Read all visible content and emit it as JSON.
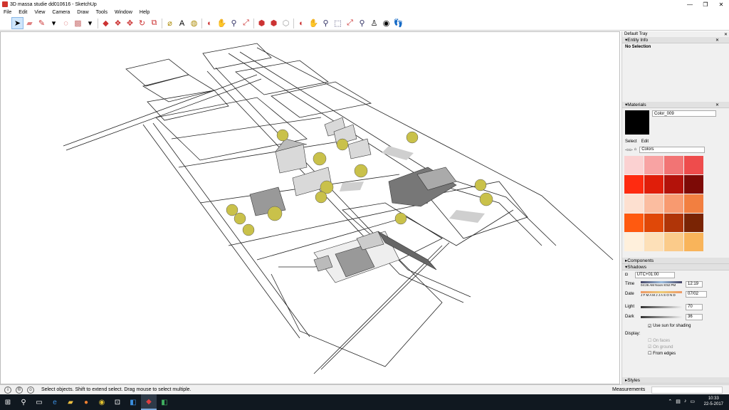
{
  "window": {
    "title": "3D massa studie dd010616 - SketchUp",
    "min": "—",
    "max": "❐",
    "close": "✕"
  },
  "menu": [
    "File",
    "Edit",
    "View",
    "Camera",
    "Draw",
    "Tools",
    "Window",
    "Help"
  ],
  "tray": {
    "title": "Default Tray",
    "entity_info": {
      "header": "Entity Info",
      "value": "No Selection"
    },
    "materials": {
      "header": "Materials",
      "name": "Color_009",
      "tab_select": "Select",
      "tab_edit": "Edit",
      "library": "Colors",
      "swatches": [
        "#fbd1d1",
        "#f8a3a3",
        "#f27474",
        "#ee4c4c",
        "#ff2b10",
        "#e01e0a",
        "#b3120a",
        "#7d0a06",
        "#fde0d0",
        "#fbbda0",
        "#f89a70",
        "#f27f40",
        "#ff5a10",
        "#e04808",
        "#b03508",
        "#7a2404",
        "#fff0dc",
        "#fde0b8",
        "#fbcb8a",
        "#f9b45a"
      ]
    },
    "components": {
      "header": "Components"
    },
    "shadows": {
      "header": "Shadows",
      "tz": "UTC+01:00",
      "time_label": "Time",
      "time_min": "04:26 AM",
      "time_noon": "Noon",
      "time_max": "8:52 PM",
      "time_value": "12:19",
      "date_label": "Date",
      "months": "J F M A M J J A S O N D",
      "date_value": "07/02",
      "light_label": "Light",
      "light_value": "70",
      "dark_label": "Dark",
      "dark_value": "36",
      "use_sun": "Use sun for shading",
      "display_label": "Display:",
      "on_faces": "On faces",
      "on_ground": "On ground",
      "from_edges": "From edges"
    },
    "styles": {
      "header": "Styles"
    }
  },
  "status": {
    "message": "Select objects. Shift to extend select. Drag mouse to select multiple.",
    "measurements": "Measurements"
  },
  "clock": {
    "time": "10:33",
    "date": "22-5-2017"
  }
}
